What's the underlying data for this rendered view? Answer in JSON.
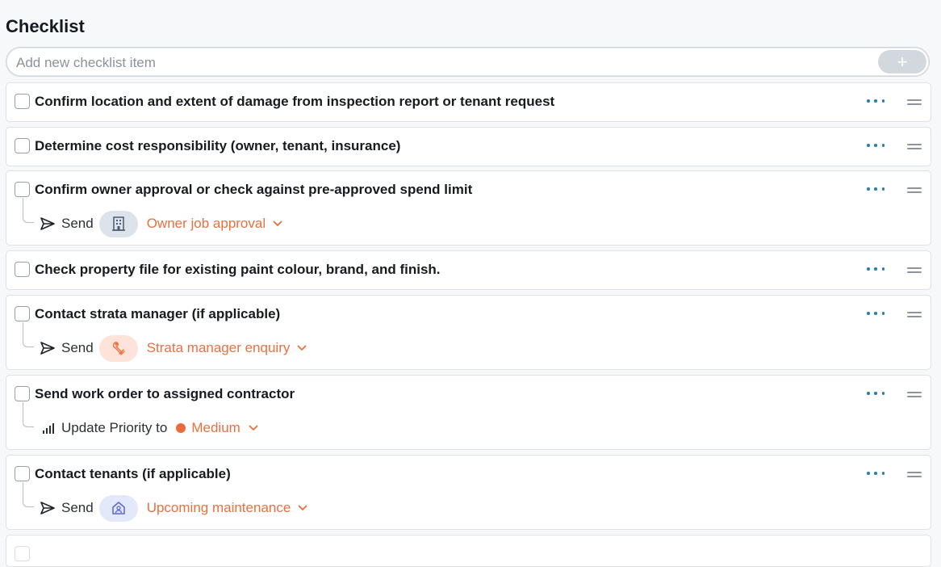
{
  "title": "Checklist",
  "add_item": {
    "placeholder": "Add new checklist item",
    "button": "+"
  },
  "items": [
    {
      "label": "Confirm location and extent of damage from inspection report or tenant request"
    },
    {
      "label": "Determine cost responsibility (owner, tenant, insurance)"
    },
    {
      "label": "Confirm owner approval or check against pre-approved spend limit",
      "action": {
        "verb": "Send",
        "icon": "building-icon",
        "template": "Owner job approval"
      }
    },
    {
      "label": "Check property file for existing paint colour, brand, and finish."
    },
    {
      "label": "Contact strata manager (if applicable)",
      "action": {
        "verb": "Send",
        "icon": "wrench-hand-icon",
        "template": "Strata manager enquiry"
      }
    },
    {
      "label": "Send work order to assigned contractor",
      "action": {
        "verb": "Update Priority to",
        "icon": "signal-bars-icon",
        "value": "Medium",
        "color": "#ec6a3c"
      }
    },
    {
      "label": "Contact tenants (if applicable)",
      "action": {
        "verb": "Send",
        "icon": "house-person-icon",
        "template": "Upcoming maintenance"
      }
    }
  ],
  "colors": {
    "accent": "#e9703f",
    "more_dots": "#2b7fb3",
    "priority_medium": "#ec6a3c"
  }
}
